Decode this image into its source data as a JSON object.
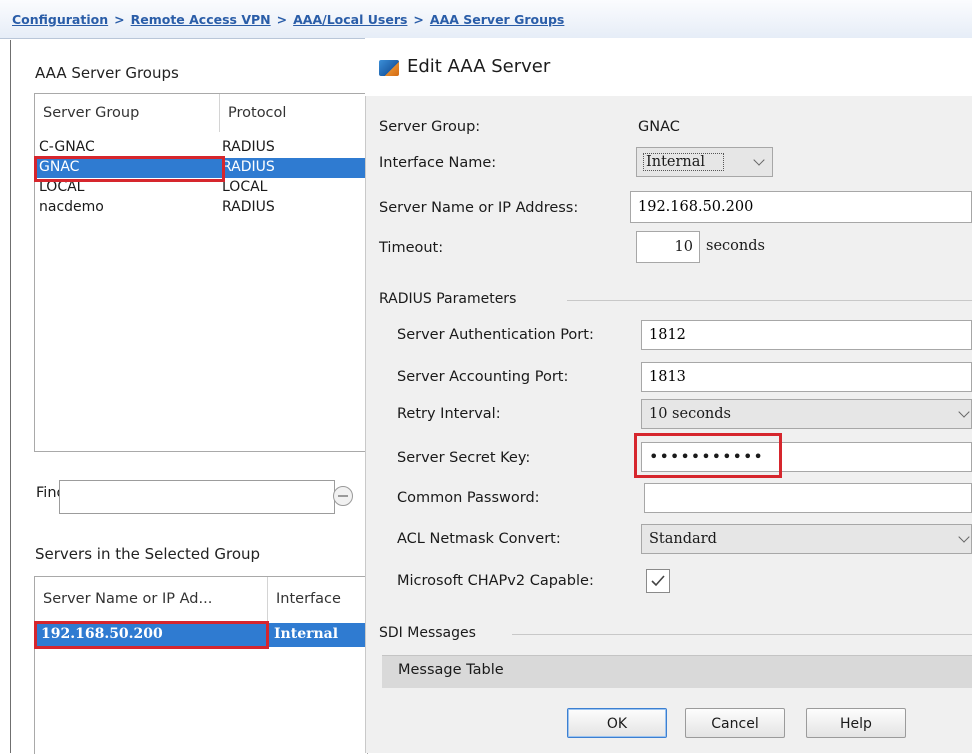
{
  "breadcrumb": {
    "items": [
      "Configuration",
      "Remote Access VPN",
      "AAA/Local Users",
      "AAA Server Groups"
    ],
    "separator": ">"
  },
  "left_pane": {
    "server_groups_title": "AAA Server Groups",
    "columns": [
      "Server Group",
      "Protocol"
    ],
    "rows": [
      {
        "group": "C-GNAC",
        "protocol": "RADIUS"
      },
      {
        "group": "GNAC",
        "protocol": "RADIUS",
        "selected": true
      },
      {
        "group": "LOCAL",
        "protocol": "LOCAL"
      },
      {
        "group": "nacdemo",
        "protocol": "RADIUS"
      }
    ],
    "find_label": "Find:",
    "find_value": "",
    "servers_title": "Servers in the Selected Group",
    "server_columns": [
      "Server Name or IP Ad...",
      "Interface"
    ],
    "server_rows": [
      {
        "server": "192.168.50.200",
        "interface": "Internal",
        "selected": true
      }
    ]
  },
  "dialog": {
    "title": "Edit AAA Server",
    "icon": "server-edit-icon",
    "server_group_label": "Server Group:",
    "server_group_value": "GNAC",
    "interface_label": "Interface Name:",
    "interface_value": "Internal",
    "server_name_label": "Server Name or IP Address:",
    "server_name_value": "192.168.50.200",
    "timeout_label": "Timeout:",
    "timeout_value": "10",
    "timeout_unit": "seconds",
    "radius_group_title": "RADIUS Parameters",
    "auth_port_label": "Server Authentication Port:",
    "auth_port_value": "1812",
    "acct_port_label": "Server Accounting Port:",
    "acct_port_value": "1813",
    "retry_label": "Retry Interval:",
    "retry_value": "10 seconds",
    "secret_label": "Server Secret Key:",
    "secret_value": "•••••••••••",
    "common_pw_label": "Common Password:",
    "common_pw_value": "",
    "acl_label": "ACL Netmask Convert:",
    "acl_value": "Standard",
    "chap_label": "Microsoft CHAPv2 Capable:",
    "chap_checked": true,
    "sdi_group_title": "SDI Messages",
    "message_table_label": "Message Table",
    "buttons": {
      "ok": "OK",
      "cancel": "Cancel",
      "help": "Help"
    }
  },
  "colors": {
    "selection": "#2f7bd1",
    "highlight_box": "#d6262d",
    "link": "#2a5da8"
  }
}
